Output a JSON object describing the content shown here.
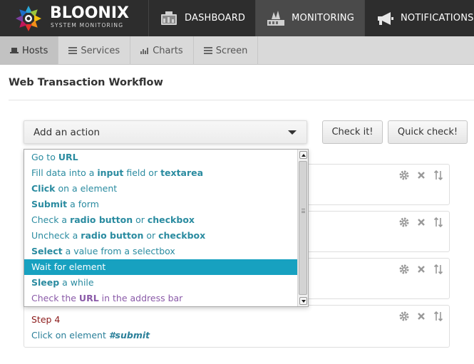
{
  "brand": {
    "name": "BLOONIX",
    "subtitle": "SYSTEM MONITORING"
  },
  "main_nav": [
    {
      "label": "DASHBOARD",
      "icon": "dashboard-icon"
    },
    {
      "label": "MONITORING",
      "icon": "monitoring-icon",
      "active": true
    },
    {
      "label": "NOTIFICATIONS",
      "icon": "megaphone-icon"
    }
  ],
  "sub_nav": [
    {
      "label": "Hosts",
      "icon": "laptop-icon",
      "active": true
    },
    {
      "label": "Services",
      "icon": "list-icon"
    },
    {
      "label": "Charts",
      "icon": "bar-chart-icon"
    },
    {
      "label": "Screen",
      "icon": "list-icon"
    }
  ],
  "page": {
    "title": "Web Transaction Workflow"
  },
  "toolbar": {
    "add_action_label": "Add an action",
    "check_label": "Check it!",
    "quick_check_label": "Quick check!"
  },
  "dropdown": {
    "items": [
      {
        "parts": [
          [
            "Go to ",
            false
          ],
          [
            "URL",
            true
          ]
        ]
      },
      {
        "parts": [
          [
            "Fill data into a ",
            false
          ],
          [
            "input",
            true
          ],
          [
            " field or ",
            false
          ],
          [
            "textarea",
            true
          ]
        ]
      },
      {
        "parts": [
          [
            "Click",
            true
          ],
          [
            " on a element",
            false
          ]
        ]
      },
      {
        "parts": [
          [
            "Submit",
            true
          ],
          [
            " a form",
            false
          ]
        ]
      },
      {
        "parts": [
          [
            "Check a ",
            false
          ],
          [
            "radio button",
            true
          ],
          [
            " or ",
            false
          ],
          [
            "checkbox",
            true
          ]
        ]
      },
      {
        "parts": [
          [
            "Uncheck a ",
            false
          ],
          [
            "radio button",
            true
          ],
          [
            " or ",
            false
          ],
          [
            "checkbox",
            true
          ]
        ]
      },
      {
        "parts": [
          [
            "Select",
            true
          ],
          [
            " a value from a selectbox",
            false
          ]
        ]
      },
      {
        "parts": [
          [
            "Wait for element",
            false
          ]
        ],
        "active": true
      },
      {
        "parts": [
          [
            "Sleep",
            true
          ],
          [
            " a while",
            false
          ]
        ]
      },
      {
        "parts": [
          [
            "Check the ",
            false
          ],
          [
            "URL",
            true
          ],
          [
            " in the address bar",
            false
          ]
        ],
        "visited": true
      }
    ]
  },
  "steps": [
    {
      "title": "",
      "desc_prefix": "",
      "desc_value": ""
    },
    {
      "title": "",
      "desc_prefix": "",
      "desc_value": ""
    },
    {
      "title": "",
      "desc_prefix": "",
      "desc_value": ""
    },
    {
      "title": "Step 4",
      "desc_prefix": "Click on element ",
      "desc_value": "#submit"
    }
  ],
  "colors": {
    "topbar": "#2d2d2d",
    "accent": "#17a1c0",
    "link": "#2a8ba0",
    "step_title": "#8b1a1a"
  }
}
